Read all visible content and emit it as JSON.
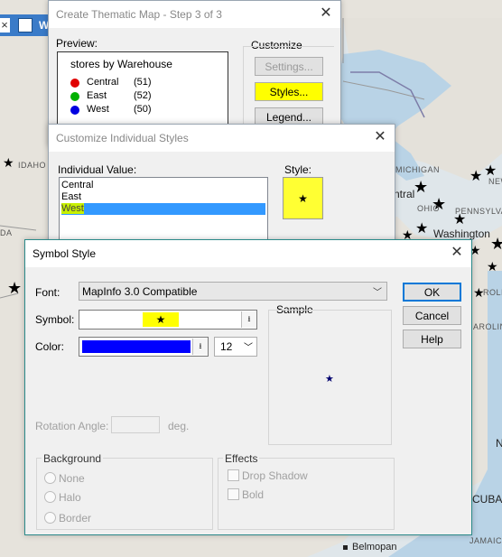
{
  "map": {
    "labels": {
      "idaho": "IDAHO",
      "michigan": "MICHIGAN",
      "ohio": "OHIO",
      "pennsylvania": "PENNSYLVANIA",
      "washington": "Washington",
      "central": "ntral",
      "cuba": "CUBA",
      "jamaica": "JAMAICA",
      "belmopan": "Belmopan",
      "carolina": "AROLINA",
      "newyork": "NEW",
      "arolina2": "ROLINA",
      "da": "DA",
      "n": "N"
    },
    "accent_color": "#000000"
  },
  "app_tab": {
    "close": "×",
    "title_fragment": "W"
  },
  "thematic": {
    "title": "Create Thematic Map - Step 3 of 3",
    "preview_label": "Preview:",
    "customize_label": "Customize",
    "legend_title": "stores by Warehouse",
    "legend_items": [
      {
        "name": "Central",
        "count": "(51)",
        "color": "#e00000"
      },
      {
        "name": "East",
        "count": "(52)",
        "color": "#00b000"
      },
      {
        "name": "West",
        "count": "(50)",
        "color": "#0000e0"
      }
    ],
    "settings_button": "Settings...",
    "styles_button": "Styles...",
    "legend_button": "Legend..."
  },
  "individual": {
    "title": "Customize Individual Styles",
    "value_label": "Individual Value:",
    "style_label": "Style:",
    "values": [
      "Central",
      "East",
      "West"
    ],
    "selected": "West"
  },
  "symbol": {
    "title": "Symbol Style",
    "font_label": "Font:",
    "font_value": "MapInfo 3.0 Compatible",
    "symbol_label": "Symbol:",
    "color_label": "Color:",
    "color_value": "#0000ff",
    "size_value": "12",
    "sample_label": "Sample",
    "rotation_label": "Rotation Angle:",
    "rotation_unit": "deg.",
    "background_label": "Background",
    "bg_options": [
      "None",
      "Halo",
      "Border"
    ],
    "effects_label": "Effects",
    "effects_options": [
      "Drop Shadow",
      "Bold"
    ],
    "ok": "OK",
    "cancel": "Cancel",
    "help": "Help"
  }
}
